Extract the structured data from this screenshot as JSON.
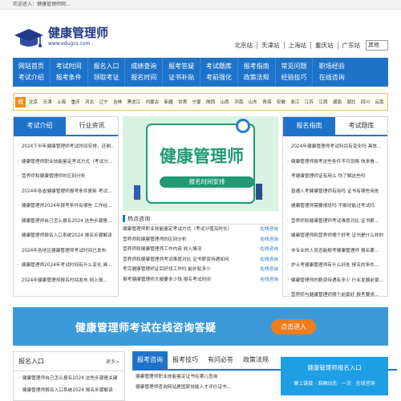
{
  "topbar": {
    "welcome": "欢迎进入：健康管理师网..."
  },
  "header": {
    "logo_title": "健康管理师",
    "logo_url": "www.edugcs.com",
    "cities": [
      "北京站",
      "天津站",
      "上海站",
      "重庆站",
      "广东站"
    ],
    "other_select": "其他"
  },
  "nav": {
    "columns": [
      [
        "网站首页",
        "考试介绍"
      ],
      [
        "考试时间",
        "报考条件"
      ],
      [
        "报名入口",
        "领取考证"
      ],
      [
        "成绩查询",
        "报名时间"
      ],
      [
        "报考答疑",
        "证书补贴"
      ],
      [
        "考试题库",
        "考前强化"
      ],
      [
        "报考指南",
        "政策法规"
      ],
      [
        "常见问题",
        "经验技巧"
      ],
      [
        "职场经验",
        "在线咨询"
      ]
    ]
  },
  "region": {
    "tag": "城市",
    "items": [
      "北京",
      "天津",
      "上海",
      "重庆",
      "河北",
      "辽宁",
      "吉林",
      "黑龙江",
      "内蒙古",
      "新疆",
      "甘肃",
      "宁夏",
      "陕西",
      "山西",
      "河南",
      "山东",
      "青海",
      "安徽",
      "浙江",
      "江苏",
      "江西",
      "湖南",
      "湖北",
      "四川",
      "云南",
      "贵州",
      "广西"
    ]
  },
  "left_panel": {
    "tabs": [
      "考试介绍",
      "行业资讯"
    ],
    "items": [
      "2024下半年健康管理师考试时间安排，还剩...",
      "健康管理师职业技能鉴定考试方式（考试分...",
      "营养师和健康管理师的区别分析",
      "2024年各省健康管理师报考条件更新 考试...",
      "健康管理师2024年报考条件有哪些 工作经...",
      "健康管理师自己怎么报名2024 这些步骤是...",
      "健康管理师报名入口系统2024 报名步骤解读",
      "2024年各地区健康管理师考试时间已发布",
      "健康管理师2024年考试时间有什么变化 具...",
      "2024年健康管理师报名时间发布 网上报..."
    ]
  },
  "banner": {
    "title": "健康管理师",
    "subtitle": "报名时间安排"
  },
  "hot": {
    "title": "热点咨询",
    "rows": [
      {
        "title": "健康管理师职业技能鉴定考试方式（考试分值及时长）",
        "tag": "在线咨询"
      },
      {
        "title": "营养师和健康管理师的区别分析",
        "tag": "在线咨询"
      },
      {
        "title": "营养师和健康管理师工作内容 收入情况",
        "tag": "在线咨询"
      },
      {
        "title": "营养师和健康管理师考试难度对比 证书薪资待遇如何",
        "tag": "在线咨询"
      },
      {
        "title": "考完健康管理师证后好找工作吗 能补贴多少",
        "tag": "在线咨询"
      },
      {
        "title": "报考健康管理师大概要多少钱 报名考试时间",
        "tag": "在线咨询"
      }
    ]
  },
  "right_panel": {
    "tabs": [
      "报名指南",
      "考试题库"
    ],
    "items": [
      "2024年健康管理师考试科目有变化吗 具体...",
      "健康管理师报考这些条件不可忽略 快来看...",
      "考健康管理师证有用么 你了解这些吗",
      "普通人考健康管理师有用吗 证书有哪些用处",
      "健康管理师需要报班吗 不报班能过考试吗",
      "营养师和健康管理师考试难度对比 证书薪...",
      "健康管理师和营养师哪个好考 证书是什么样的",
      "非专业的人员否能报考健康管理师 报名要...",
      "护士考健康管理师有什么好处 报名的条件...",
      "健康管理师的薪资待遇有多少 行业发展前景...",
      "营养师与健康管理师哪个前景好 报考要求..."
    ]
  },
  "adbar": {
    "text": "健康管理师考试在线咨询答疑",
    "button": "点击进入"
  },
  "bottom_left": {
    "title": "报名入口",
    "more": "更多>",
    "items": [
      "健康管理师自己怎么报名2024 这些步骤是关键",
      "健康管理师报名入口系统2024 报名步骤解读"
    ]
  },
  "bottom_mid": {
    "tabs": [
      "报考咨询",
      "报考技巧",
      "有问必答",
      "政策法规"
    ],
    "rows": [
      "健康管理师职业技能鉴定证书在哪儿查询",
      "健康管理师查询网站是国家技能人才评价证书..."
    ]
  },
  "side_card": {
    "title": "健康管理师报名入口",
    "mini": "聊上链接 · 准确动态 · 一次 · 在线咨询"
  },
  "colors": {
    "primary": "#1e73c9",
    "accent": "#f07c1c",
    "banner_green": "#1f9a74"
  },
  "icons": {
    "logo": "graduation-cap-icon"
  }
}
